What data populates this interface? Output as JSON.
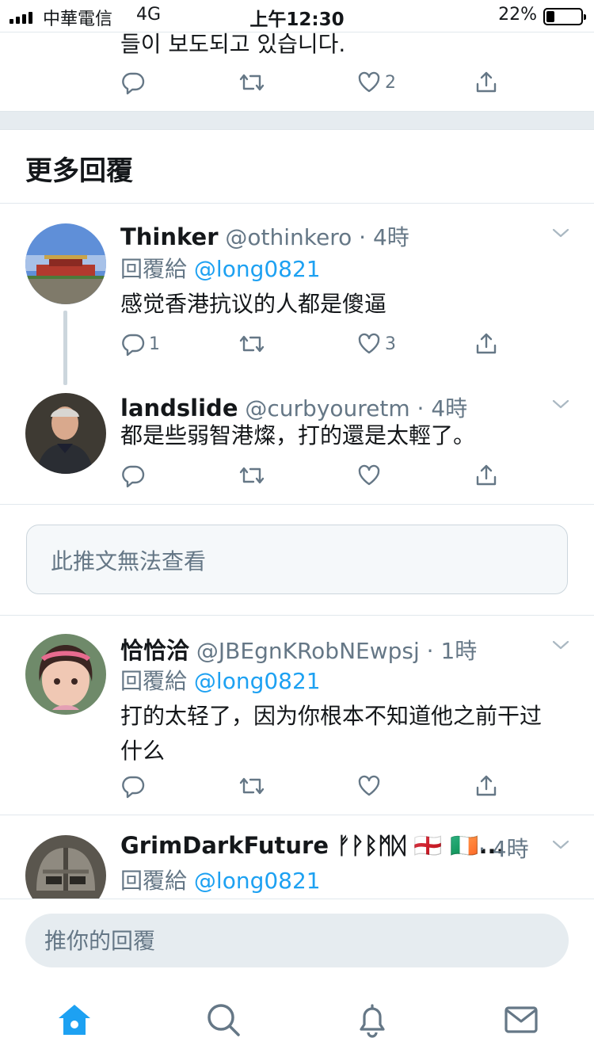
{
  "status_bar": {
    "carrier": "中華電信",
    "network": "4G",
    "time": "上午12:30",
    "battery": "22%"
  },
  "previous_tweet": {
    "text_fragment": "들이 보도되고 있습니다.",
    "like_count": "2"
  },
  "section_title": "更多回覆",
  "tweets": [
    {
      "name": "Thinker",
      "handle": "@othinkero",
      "time": "· 4時",
      "reply_prefix": "回覆給",
      "reply_to": "@long0821",
      "text": "感觉香港抗议的人都是傻逼",
      "reply_count": "1",
      "like_count": "3"
    },
    {
      "name": "landslide",
      "handle": "@curbyouretm",
      "time": "· 4時",
      "text": "都是些弱智港燦，打的還是太輕了。"
    },
    {
      "name": "恰恰洽",
      "handle": "@JBEgnKRobNEwpsj",
      "time": "· 1時",
      "reply_prefix": "回覆給",
      "reply_to": "@long0821",
      "text": "打的太轻了，因为你根本不知道他之前干过什么"
    },
    {
      "name": "GrimDarkFuture ᚠᚹᛒᛗᛞ 🏴󠁧󠁢󠁥󠁮󠁧󠁿 🇮🇪...",
      "time": "· 4時",
      "reply_prefix": "回覆給",
      "reply_to": "@long0821"
    }
  ],
  "unavailable_notice": "此推文無法查看",
  "composer_placeholder": "推你的回覆",
  "accent_color": "#1da1f2",
  "icons": [
    "reply-icon",
    "retweet-icon",
    "like-icon",
    "share-icon",
    "chevron-down-icon",
    "home-icon",
    "search-icon",
    "bell-icon",
    "mail-icon"
  ]
}
